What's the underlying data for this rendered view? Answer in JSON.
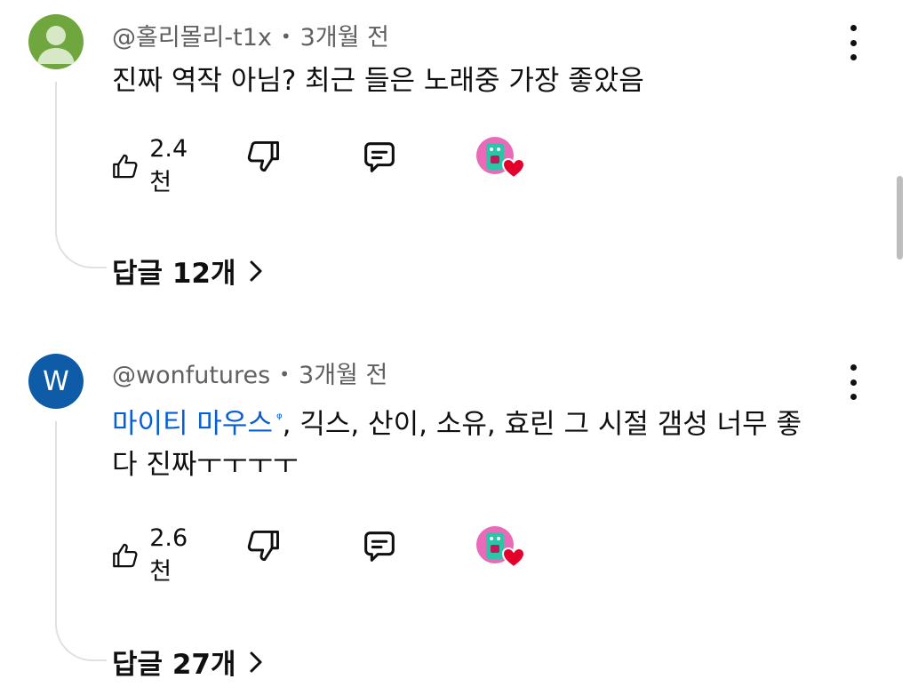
{
  "comments": [
    {
      "author": "@홀리몰리-t1x",
      "time": "3개월 전",
      "text": "진짜 역작 아님? 최근 들은 노래중 가장 좋았음",
      "likes": "2.4천",
      "replies": "답글 12개",
      "avatar_color": "#6fa73e",
      "avatar_icon": "default-person-icon"
    },
    {
      "author": "@wonfutures",
      "time": "3개월 전",
      "avatar_letter": "W",
      "avatar_color": "#0e5ca8",
      "mention": "마이티 마우스",
      "mention_marker": "ᵠ",
      "text_after_mention": ", 긱스, 산이, 소유, 효린 그 시절 갬성 너무 좋다 진짜ㅜㅜㅜㅜ",
      "likes": "2.6천",
      "replies": "답글 27개"
    }
  ],
  "colors": {
    "mention": "#065fd4",
    "meta": "#606060",
    "heart": "#e4002b"
  }
}
